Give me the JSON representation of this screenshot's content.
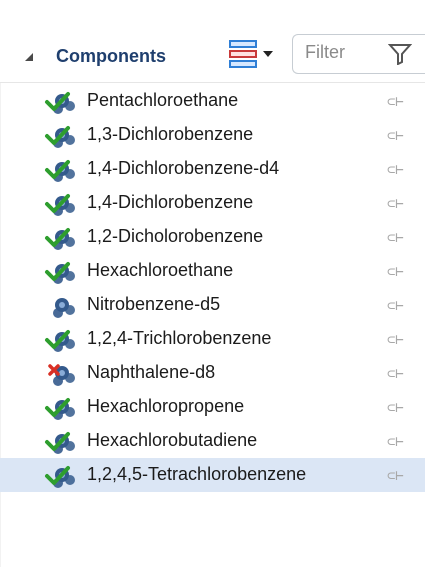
{
  "panel": {
    "title": "Components",
    "filter_placeholder": "Filter",
    "accent": "#1f3f6e"
  },
  "items": [
    {
      "label": "Pentachloroethane",
      "status": "check"
    },
    {
      "label": "1,3-Dichlorobenzene",
      "status": "check"
    },
    {
      "label": "1,4-Dichlorobenzene-d4",
      "status": "check"
    },
    {
      "label": "1,4-Dichlorobenzene",
      "status": "check"
    },
    {
      "label": "1,2-Dicholorobenzene",
      "status": "check"
    },
    {
      "label": "Hexachloroethane",
      "status": "check"
    },
    {
      "label": "Nitrobenzene-d5",
      "status": "none"
    },
    {
      "label": "1,2,4-Trichlorobenzene",
      "status": "check"
    },
    {
      "label": "Naphthalene-d8",
      "status": "error"
    },
    {
      "label": "Hexachloropropene",
      "status": "check"
    },
    {
      "label": "Hexachlorobutadiene",
      "status": "check"
    },
    {
      "label": "1,2,4,5-Tetrachlorobenzene",
      "status": "check"
    }
  ],
  "icons": {
    "compound": "molecule-icon",
    "status_check": "green-check-icon",
    "status_error": "red-x-icon",
    "row_signature": "link-icon"
  },
  "colors": {
    "selected_row": "#dbe6f5",
    "check": "#2e9e2e",
    "error": "#d93025",
    "molecule": "#345a8c"
  }
}
